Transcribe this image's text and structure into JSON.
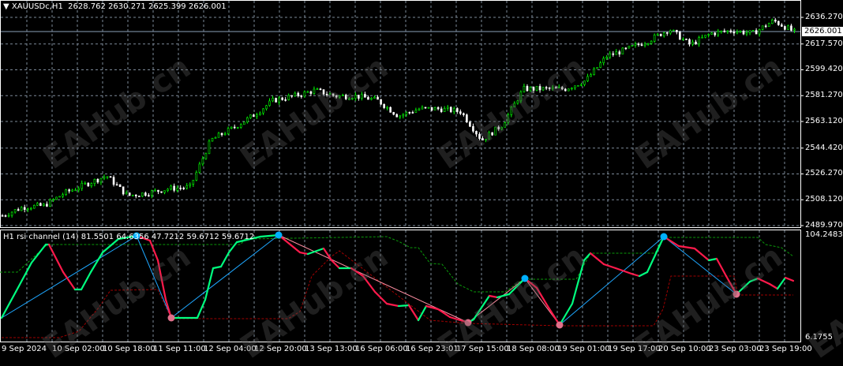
{
  "header": {
    "symbol": "XAUUSDc,H1",
    "ohlc": "2628.762 2630.271 2625.399 2626.001"
  },
  "indicator": {
    "label": "H1 rsi channel (14) 81.5501 64.6356 47.7212 59.6712 59.6712",
    "max": "104.2483",
    "min": "6.1755"
  },
  "current_price": "2626.001",
  "watermark": "EAHub.cn",
  "colors": {
    "bull": "#00ff00",
    "bear": "#ffffff",
    "rsi_up": "#00ff7f",
    "rsi_down": "#ff1a4b",
    "zig_up": "#1ea7ff",
    "zig_down": "#ff8fa3",
    "dot_high": "#00b0ff",
    "dot_low": "#e0708a"
  },
  "chart_data": {
    "type": "candlestick",
    "price_axis": [
      "2636.270",
      "2617.570",
      "2599.420",
      "2581.270",
      "2563.120",
      "2544.420",
      "2526.270",
      "2508.120",
      "2489.970"
    ],
    "ylim": [
      2489.97,
      2636.27
    ],
    "time_axis": [
      "9 Sep 2024",
      "10 Sep 02:00",
      "10 Sep 18:00",
      "11 Sep 11:00",
      "12 Sep 04:00",
      "12 Sep 20:00",
      "13 Sep 13:00",
      "16 Sep 06:00",
      "16 Sep 23:01",
      "17 Sep 15:00",
      "18 Sep 08:00",
      "19 Sep 01:00",
      "19 Sep 17:00",
      "20 Sep 10:00",
      "23 Sep 03:00",
      "23 Sep 19:00"
    ],
    "close_path": [
      2497,
      2503,
      2504,
      2513,
      2519,
      2525,
      2511,
      2513,
      2516,
      2517,
      2550,
      2558,
      2567,
      2578,
      2581,
      2585,
      2581,
      2581,
      2578,
      2567,
      2572,
      2572,
      2570,
      2550,
      2561,
      2586,
      2586,
      2586,
      2592,
      2609,
      2614,
      2620,
      2628,
      2617,
      2625,
      2627,
      2625,
      2634,
      2626
    ],
    "rsi_range": [
      6.1755,
      104.2483
    ]
  }
}
